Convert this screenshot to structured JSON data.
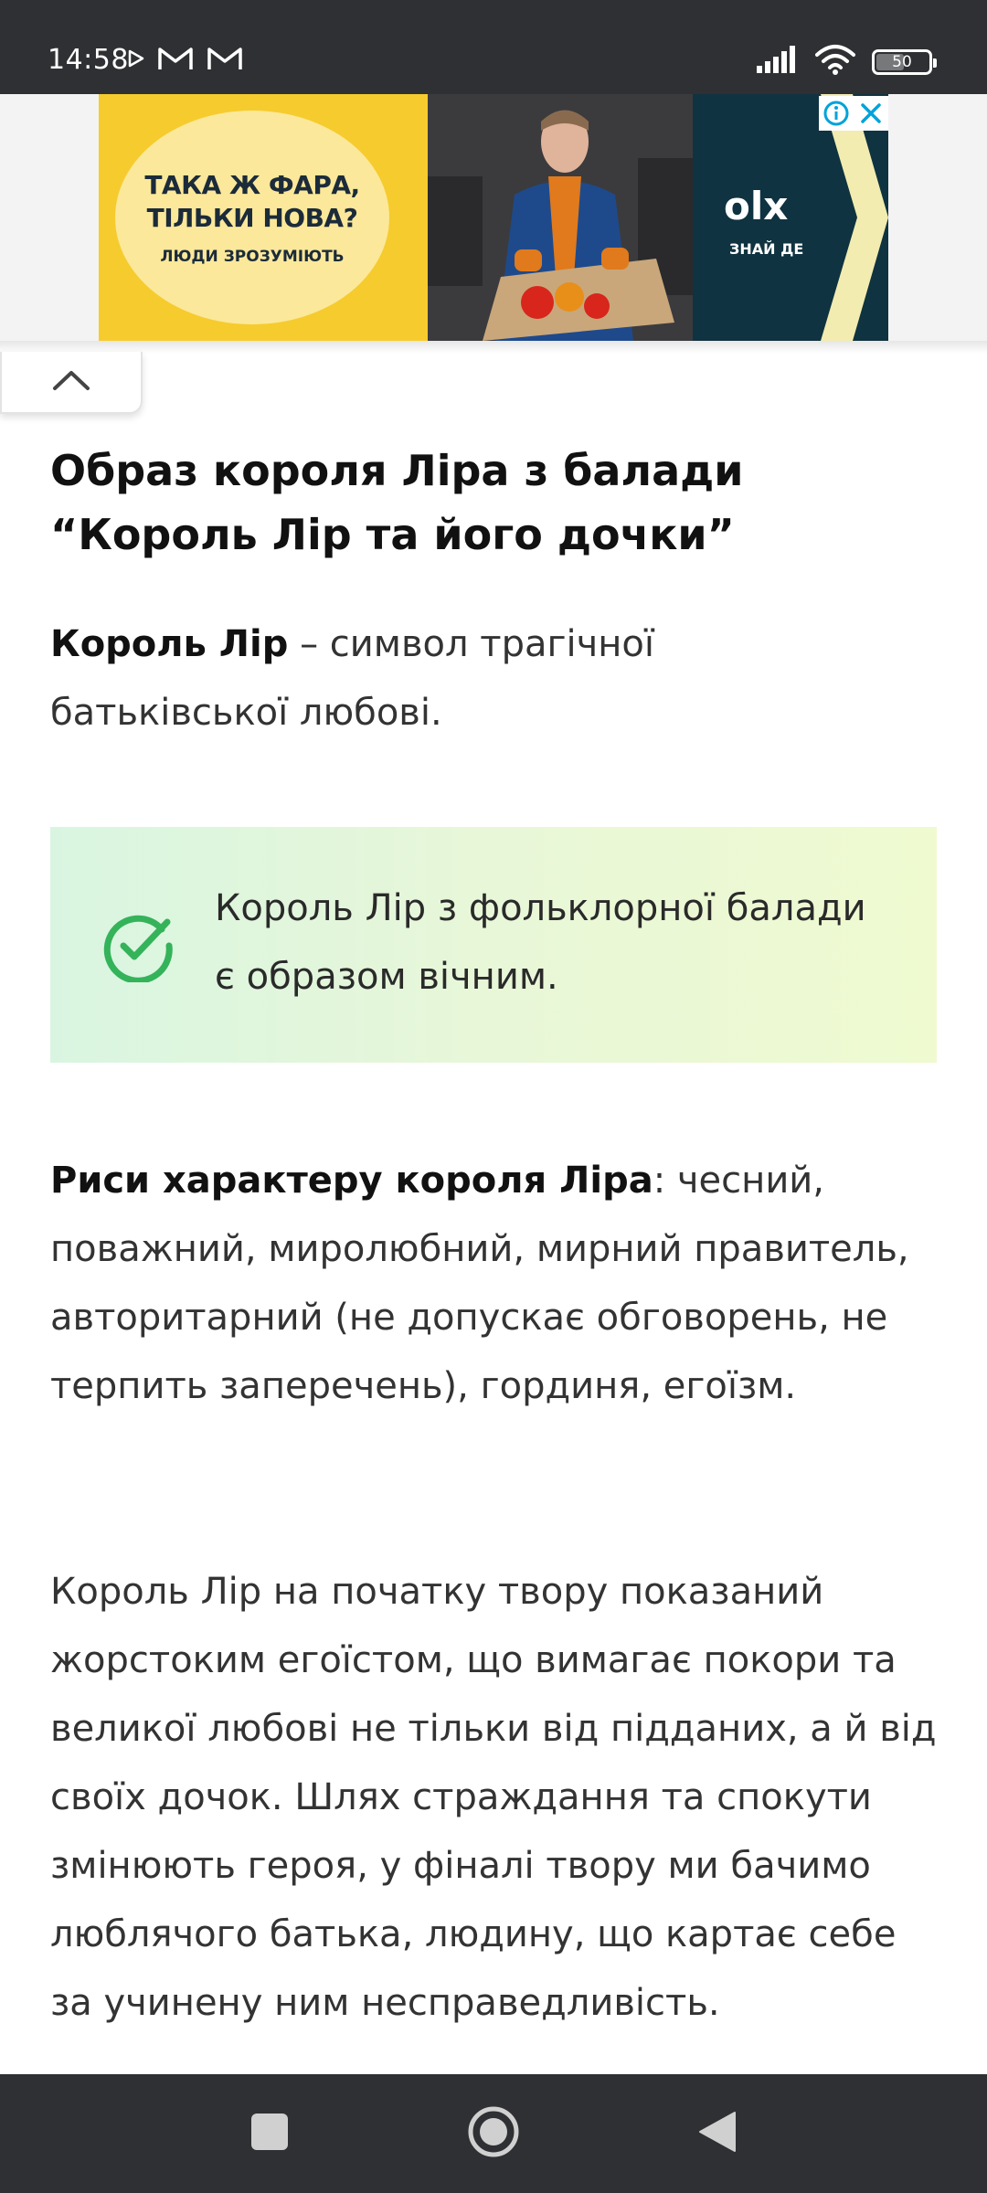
{
  "status_bar": {
    "time": "14:58",
    "left_icons": [
      "play-store-icon",
      "gmail-icon",
      "gmail-icon"
    ],
    "right_icons": [
      "signal-icon",
      "wifi-icon",
      "battery-icon"
    ],
    "battery_level": "50"
  },
  "ad": {
    "headline": "ТАКА Ж ФАРА,\nТІЛЬКИ НОВА?",
    "subline": "ЛЮДИ ЗРОЗУМІЮТЬ",
    "brand": "olx",
    "tagline": "ЗНАЙ ДЕ",
    "colors": {
      "yellow": "#f6cb2d",
      "dark_teal": "#0f3340",
      "cyan": "#00a3d9"
    }
  },
  "collapse_button": {
    "icon": "chevron-up-icon"
  },
  "article": {
    "title": "Образ короля Ліра з балади “Король Лір та його дочки”",
    "para1_bold": "Король Лір",
    "para1_rest": " – символ трагічної батьківської любові.",
    "callout_text": "Король Лір з фольклорної балади є образом вічним.",
    "callout_icon": "check-circle-icon",
    "para2_bold": "Риси характеру короля Ліра",
    "para2_rest": ": чесний, поважний, миролюбний, мирний правитель, авторитарний (не допускає обговорень, не терпить заперечень), гординя, егоїзм.",
    "para3": "Король Лір на початку твору показаний жорстоким егоїстом, що вимагає покори та великої любові не тільки від підданих, а й від своїх дочок. Шлях страждання та спокути змінюють героя, у фіналі твору ми бачимо люблячого батька, людину, що картає себе за учинену ним несправедливість."
  },
  "nav_bar": {
    "buttons": [
      "recents-square-icon",
      "home-circle-icon",
      "back-triangle-icon"
    ]
  }
}
